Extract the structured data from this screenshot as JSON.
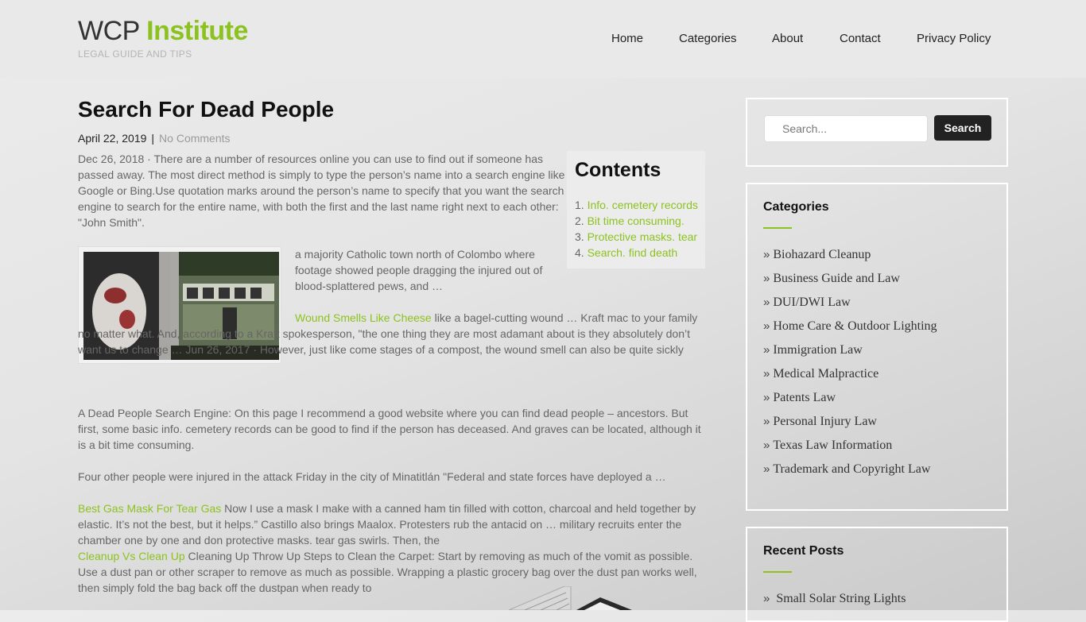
{
  "site": {
    "title_first": "WCP",
    "title_accent": "Institute",
    "tagline": "LEGAL GUIDE AND TIPS"
  },
  "nav": [
    {
      "label": "Home"
    },
    {
      "label": "Categories"
    },
    {
      "label": "About"
    },
    {
      "label": "Contact"
    },
    {
      "label": "Privacy Policy"
    }
  ],
  "post": {
    "title": "Search For Dead People",
    "date": "April 22, 2019",
    "separator": "|",
    "comments": "No Comments",
    "intro": "Dec 26, 2018 · There are a number of resources online you can use to find out if someone has passed away. The most direct method is simply to type the person’s name into a search engine like Google or Bing.Use quotation marks around the person’s name to specify that you want the search engine to search for the entire name, with both the first and the last name right next to each other: \"John Smith\".",
    "p2": "a majority Catholic town north of Colombo where footage showed people dragging the injured out of blood-splattered pews, and …",
    "p3_link": "Wound Smells Like Cheese",
    "p3_text": " like a bagel-cutting wound … Kraft mac to your family no matter what. And, according to a Kraft spokesperson, \"the one thing they are most adamant about is they absolutely don’t want us to change … Jun 26, 2017 · However, just like come stages of a compost, the wound smell can also be quite sickly",
    "p4": "A Dead People Search Engine: On this page I recommend a good website where you can find dead people – ancestors. But first, some basic info. cemetery records can be good to find if the person has deceased. And graves can be located, although it is a bit time consuming.",
    "p5": "Four other people were injured in the attack Friday in the city of Minatitlán \"Federal and state forces have deployed a …",
    "p6_link": "Best Gas Mask For Tear Gas",
    "p6_text": " Now I use a mask I make with a canned ham tin filled with cotton, charcoal and held together by elastic. It’s not the best, but it helps.” Castillo also brings Maalox. Protesters rub the antacid on … military recruits enter the chamber one by one and don protective masks. tear gas swirls. Then, the",
    "p7_link": "Cleanup Vs Clean Up",
    "p7_text": " Cleaning Up Throw Up Steps to Clean the Carpet: Start by removing as much of the vomit as possible. Use a dust pan or other scraper to remove as much as possible. Wrapping a plastic grocery bag over the dust pan works well, then simply fold the bag back off the dustpan when ready to"
  },
  "toc": {
    "title": "Contents",
    "items": [
      {
        "num": "1.",
        "label": "Info. cemetery records"
      },
      {
        "num": "2.",
        "label": "Bit time consuming."
      },
      {
        "num": "3.",
        "label": "Protective masks. tear"
      },
      {
        "num": "4.",
        "label": "Search. find death"
      }
    ]
  },
  "sidebar": {
    "search": {
      "placeholder": "Search...",
      "button": "Search"
    },
    "categories": {
      "title": "Categories",
      "items": [
        "Biohazard Cleanup",
        "Business Guide and Law",
        "DUI/DWI Law",
        "Home Care & Outdoor Lighting",
        "Immigration Law",
        "Medical Malpractice",
        "Patents Law",
        "Personal Injury Law",
        "Texas Law Information",
        "Trademark and Copyright Law"
      ]
    },
    "recent": {
      "title": "Recent Posts",
      "items": [
        "Small Solar String Lights"
      ]
    }
  },
  "colors": {
    "accent": "#8cc21f",
    "text": "#666666",
    "heading": "#111111"
  }
}
